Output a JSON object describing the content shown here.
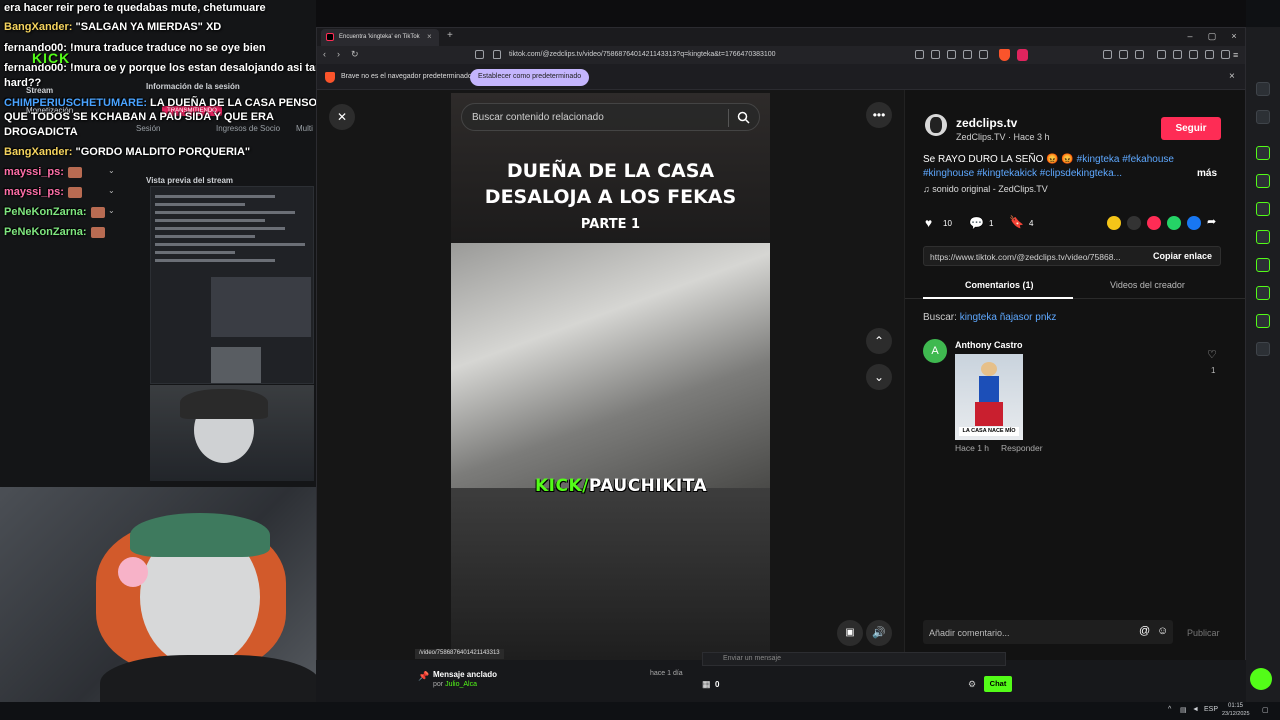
{
  "chat": {
    "lines": [
      {
        "user": "",
        "text": "era hacer reir pero te quedabas mute, chetumuare"
      },
      {
        "user": "BangXander:",
        "text": " \"SALGAN YA MIERDAS\" XD"
      },
      {
        "user": "fernando00:",
        "text": " !mura traduce traduce no se oye bien"
      },
      {
        "user": "fernando00:",
        "text": " !mura oe y porque los estan desalojando asi tan"
      },
      {
        "user": "",
        "text": "hard??"
      },
      {
        "user": "CHIMPERIUSCHETUMARE:",
        "text": " LA DUEÑA DE LA CASA PENSO"
      },
      {
        "user": "",
        "text": "QUE TODOS SE KCHABAN A PAU SIDA Y QUE ERA"
      },
      {
        "user": "",
        "text": "DROGADICTA"
      },
      {
        "user": "BangXander:",
        "text": " \"GORDO MALDITO PORQUERIA\""
      },
      {
        "user": "mayssi_ps:",
        "text": ""
      },
      {
        "user": "mayssi_ps:",
        "text": ""
      },
      {
        "user": "PeNeKonZarna:",
        "text": ""
      },
      {
        "user": "PeNeKonZarna:",
        "text": ""
      }
    ],
    "kick_logo": "KICK"
  },
  "studio": {
    "stream_label": "Stream",
    "monetizacion_label": "Monetización",
    "session_info_label": "Información de la sesión",
    "session_label": "Sesión",
    "ingresos_label": "Ingresos de Socio",
    "multi_label": "Multi",
    "transmitiendo_label": "TRANSMITIENDO",
    "preview_label": "Vista previa del stream"
  },
  "browser": {
    "tab_title": "Encuentra 'kingteka' en TikTok",
    "url": "tiktok.com/@zedclips.tv/video/7586876401421143313?q=kingteka&t=1766470383100",
    "info_text": "Brave no es el navegador predeterminado",
    "info_button": "Establecer como predeterminado",
    "status_url": "/video/7586876401421143313"
  },
  "video": {
    "search_placeholder": "Buscar contenido relacionado",
    "title_line1": "DUEÑA DE LA CASA",
    "title_line2": "DESALOJA A LOS FEKAS",
    "part": "PARTE 1",
    "kick_prefix": "KICK/",
    "kick_name": "PAUCHIKITA"
  },
  "post": {
    "username": "zedclips.tv",
    "display_name": "ZedClips.TV · Hace 3 h",
    "follow_label": "Seguir",
    "caption_text": "Se RAYO DURO LA SEÑO 😡 😡",
    "tags_line1": "#kingteka #fekahouse",
    "tags_line2": "#kinghouse #kingtekakick #clipsdekingteka...",
    "more_label": "más",
    "sound": "♫  sonido original - ZedClips.TV",
    "likes": "10",
    "comments": "1",
    "saves": "4",
    "link": "https://www.tiktok.com/@zedclips.tv/video/75868...",
    "copy_label": "Copiar enlace",
    "tab_comments": "Comentarios (1)",
    "tab_videos": "Videos del creador",
    "search_prefix": "Buscar:",
    "search_term": "kingteka ñajasor pnkz",
    "comment_author": "Anthony Castro",
    "comment_avatar": "A",
    "comment_gif_caption": "LA CASA NACE MÍO",
    "comment_time": "Hace 1 h",
    "reply_label": "Responder",
    "comment_likes": "1",
    "add_comment_placeholder": "Añadir comentario...",
    "publish_label": "Publicar"
  },
  "bottom": {
    "pinned_title": "Mensaje anclado",
    "pinned_by": "por",
    "pinned_user": "Julio_Alca",
    "pinned_time": "hace 1 día",
    "chat_placeholder": "Enviar un mensaje",
    "viewers": "0",
    "chat_button": "Chat"
  },
  "taskbar": {
    "lang": "ESP",
    "time": "01:15",
    "date": "23/12/2025"
  },
  "colors": {
    "accent_follow": "#fe2c55",
    "kick_green": "#53fc18",
    "hashtag": "#5ea8ff"
  }
}
